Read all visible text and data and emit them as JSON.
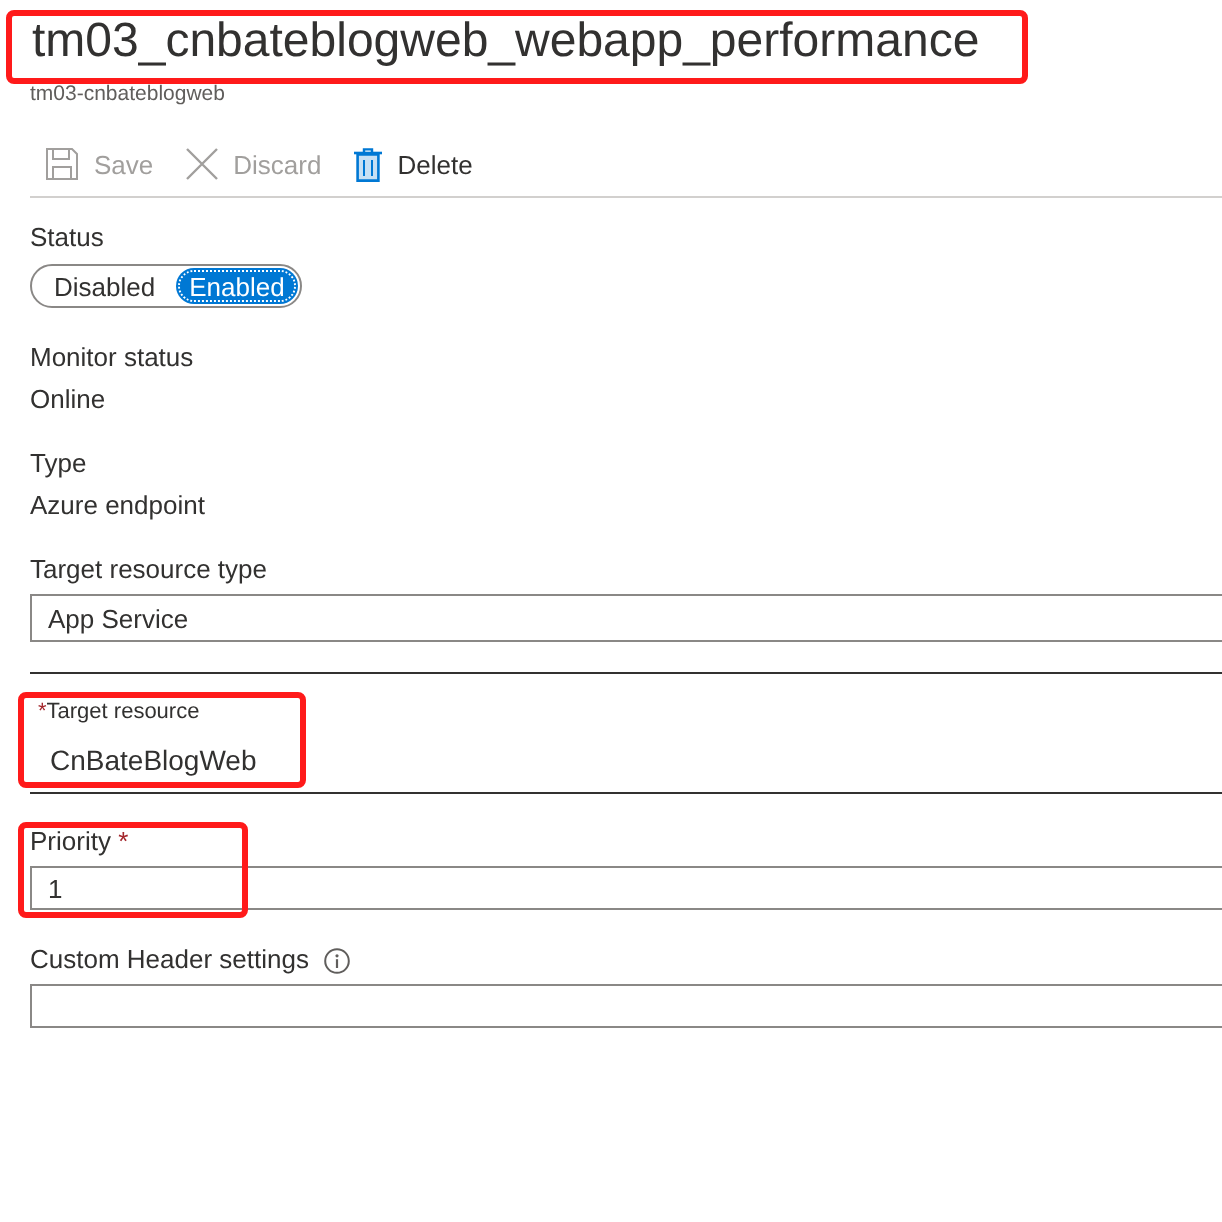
{
  "header": {
    "title": "tm03_cnbateblogweb_webapp_performance",
    "highlighted": true,
    "subtitle": "tm03-cnbateblogweb"
  },
  "toolbar": [
    {
      "kind": "save",
      "label": "Save",
      "disabled": true
    },
    {
      "kind": "discard",
      "label": "Discard",
      "disabled": true
    },
    {
      "kind": "delete",
      "label": "Delete",
      "disabled": false
    }
  ],
  "status": {
    "label": "Status",
    "options": [
      {
        "label": "Disabled",
        "selected": false
      },
      {
        "label": "Enabled",
        "selected": true
      }
    ]
  },
  "info": [
    {
      "label": "Monitor status",
      "value": "Online"
    },
    {
      "label": "Type",
      "value": "Azure endpoint"
    }
  ],
  "fields": [
    {
      "kind": "boxed",
      "label": "Target resource type",
      "value": "App Service",
      "highlighted": false
    },
    {
      "kind": "floating",
      "label": "Target resource",
      "required_mark": "*",
      "value": "CnBateBlogWeb",
      "highlighted": true
    },
    {
      "kind": "boxed",
      "label": "Priority",
      "required_mark": "*",
      "value": "1",
      "highlighted": true
    },
    {
      "kind": "boxed",
      "label": "Custom Header settings",
      "info_icon": true,
      "highlighted": false
    }
  ]
}
